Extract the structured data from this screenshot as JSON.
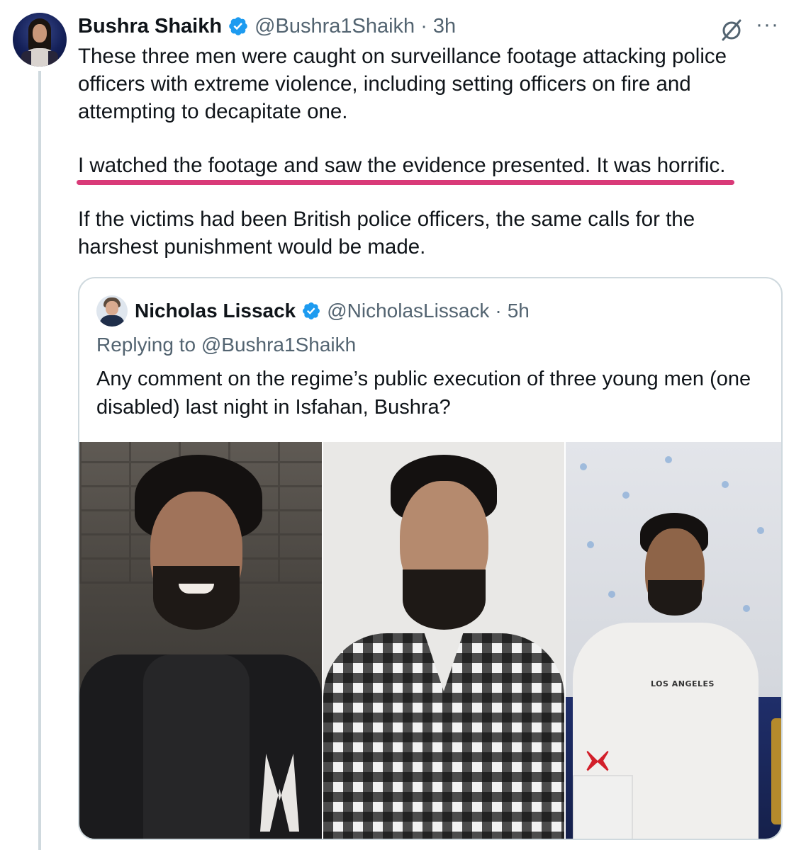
{
  "tweet": {
    "author_name": "Bushra Shaikh",
    "author_handle": "@Bushra1Shaikh",
    "separator": "·",
    "time": "3h",
    "paragraphs": [
      [
        "These three men were caught on surveillance footage attacking police",
        "officers with extreme violence, including setting officers on fire and",
        "attempting to decapitate one."
      ],
      [
        "I watched the footage and saw the evidence presented. It was horrific."
      ],
      [
        "If the victims had been British police officers, the same calls for the",
        "harshest punishment would be made."
      ]
    ],
    "more_label": "···",
    "highlight_color": "#d93a78"
  },
  "quote": {
    "author_name": "Nicholas Lissack",
    "author_handle": "@NicholasLissack",
    "separator": "·",
    "time": "5h",
    "replying_to": "Replying to @Bushra1Shaikh",
    "text_lines": [
      "Any comment on the regime’s public execution of three young men (one",
      "disabled) last night in Isfahan, Bushra?"
    ],
    "photo_shirt_text": "LOS ANGELES"
  },
  "icons": {
    "verified": "verified-badge-icon",
    "grok": "grok-icon",
    "more": "more-icon"
  },
  "colors": {
    "verified": "#1d9bf0",
    "text_primary": "#0f1419",
    "text_secondary": "#536471",
    "border": "#cfd9de"
  }
}
